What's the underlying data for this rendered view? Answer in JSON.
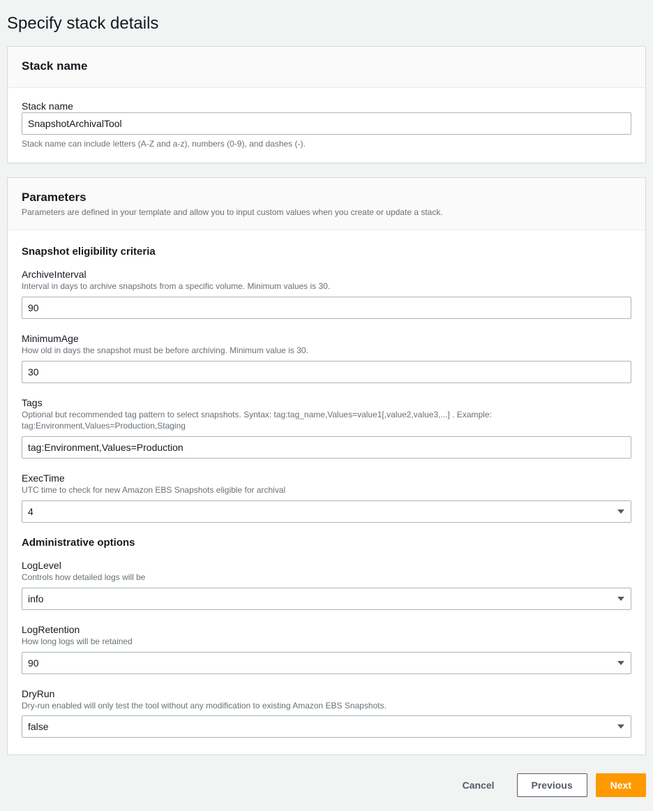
{
  "page": {
    "title": "Specify stack details"
  },
  "stackNamePanel": {
    "header": "Stack name",
    "field": {
      "label": "Stack name",
      "value": "SnapshotArchivalTool",
      "hint": "Stack name can include letters (A-Z and a-z), numbers (0-9), and dashes (-)."
    }
  },
  "parametersPanel": {
    "header": "Parameters",
    "desc": "Parameters are defined in your template and allow you to input custom values when you create or update a stack.",
    "sections": {
      "eligibility": {
        "title": "Snapshot eligibility criteria",
        "archiveInterval": {
          "label": "ArchiveInterval",
          "desc": "Interval in days to archive snapshots from a specific volume. Minimum values is 30.",
          "value": "90"
        },
        "minimumAge": {
          "label": "MinimumAge",
          "desc": "How old in days the snapshot must be before archiving. Minimum value is 30.",
          "value": "30"
        },
        "tags": {
          "label": "Tags",
          "desc": "Optional but recommended tag pattern to select snapshots. Syntax: tag:tag_name,Values=value1[,value2,value3,...] . Example: tag:Environment,Values=Production,Staging",
          "value": "tag:Environment,Values=Production"
        },
        "execTime": {
          "label": "ExecTime",
          "desc": "UTC time to check for new Amazon EBS Snapshots eligible for archival",
          "value": "4"
        }
      },
      "admin": {
        "title": "Administrative options",
        "logLevel": {
          "label": "LogLevel",
          "desc": "Controls how detailed logs will be",
          "value": "info"
        },
        "logRetention": {
          "label": "LogRetention",
          "desc": "How long logs will be retained",
          "value": "90"
        },
        "dryRun": {
          "label": "DryRun",
          "desc": "Dry-run enabled will only test the tool without any modification to existing Amazon EBS Snapshots.",
          "value": "false"
        }
      }
    }
  },
  "footer": {
    "cancel": "Cancel",
    "previous": "Previous",
    "next": "Next"
  }
}
